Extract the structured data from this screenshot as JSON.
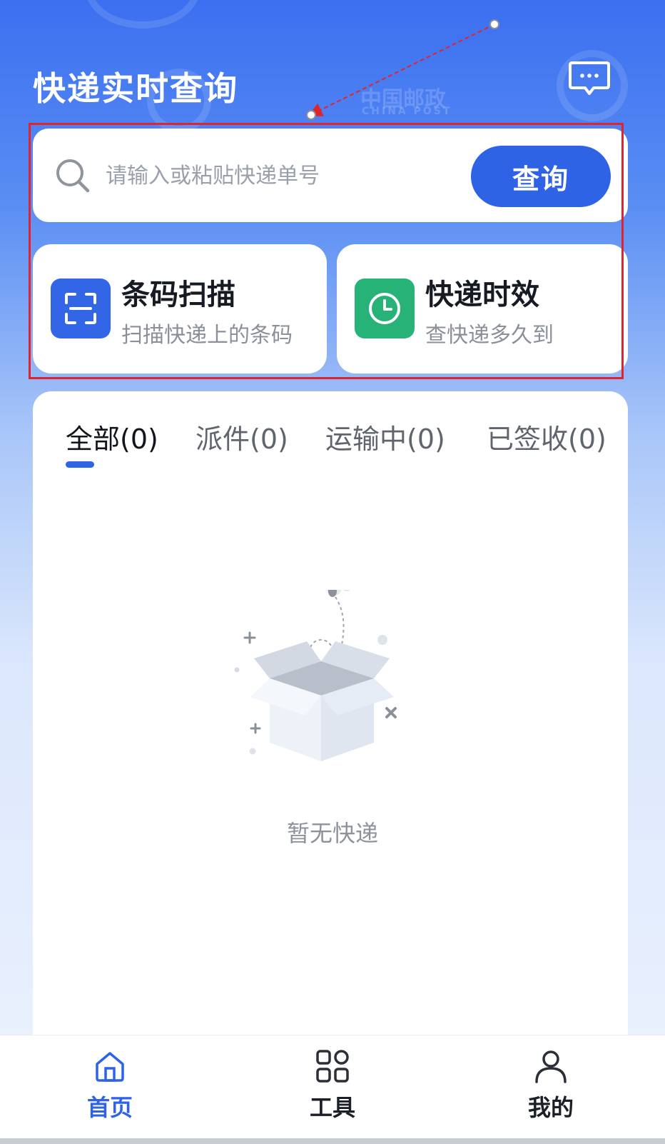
{
  "header": {
    "title": "快递实时查询",
    "message_icon": "message-icon"
  },
  "background_logos": {
    "china_post_cn": "中国邮政",
    "china_post_en": "CHINA POST"
  },
  "search": {
    "placeholder": "请输入或粘贴快递单号",
    "value": "",
    "button_label": "查询",
    "icon": "search-icon"
  },
  "features": [
    {
      "title": "条码扫描",
      "subtitle": "扫描快递上的条码",
      "icon": "scan-icon",
      "color": "#3266e7"
    },
    {
      "title": "快递时效",
      "subtitle": "查快递多久到",
      "icon": "clock-icon",
      "color": "#27b277"
    }
  ],
  "tabs": [
    {
      "label": "全部(0)",
      "active": true
    },
    {
      "label": "派件(0)",
      "active": false
    },
    {
      "label": "运输中(0)",
      "active": false
    },
    {
      "label": "已签收(0)",
      "active": false
    }
  ],
  "empty_state": {
    "text": "暂无快递",
    "icon": "empty-box-icon"
  },
  "bottom_nav": [
    {
      "label": "首页",
      "icon": "home-icon",
      "active": true
    },
    {
      "label": "工具",
      "icon": "tools-grid-icon",
      "active": false
    },
    {
      "label": "我的",
      "icon": "user-icon",
      "active": false
    }
  ],
  "colors": {
    "accent": "#2f63e6",
    "scan_icon_bg": "#3266e7",
    "clock_icon_bg": "#27b277",
    "annotation": "#e0242d"
  }
}
